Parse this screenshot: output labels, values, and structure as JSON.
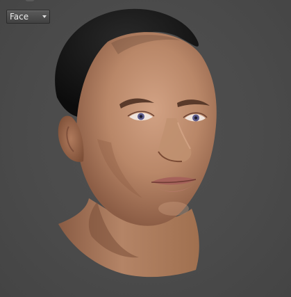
{
  "viewer": {
    "view_selector": {
      "selected": "Face",
      "icon": "chevron-down-icon"
    },
    "background_color": "#4a4a4a",
    "model": {
      "name": "head-model",
      "skin_color": "#c08e70",
      "hair_color": "#151515"
    }
  }
}
